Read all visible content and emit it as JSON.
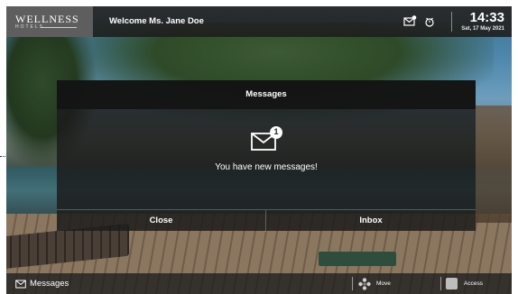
{
  "header": {
    "logo_main": "WELLNESS",
    "logo_sub": "HOTELS",
    "welcome": "Welcome Ms. Jane Doe",
    "time": "14:33",
    "date": "Sat, 17 May 2021",
    "icons": [
      "message-alert-icon",
      "alarm-clock-icon"
    ]
  },
  "modal": {
    "title": "Messages",
    "badge_count": "1",
    "message": "You have new messages!",
    "close_label": "Close",
    "inbox_label": "Inbox",
    "icon": "envelope-icon"
  },
  "footer": {
    "messages_label": "Messages",
    "move_label": "Move",
    "access_label": "Access"
  },
  "colors": {
    "bar_bg": "#1c1c1c",
    "logo_bg": "#5e5e5e",
    "text": "#ffffff"
  }
}
